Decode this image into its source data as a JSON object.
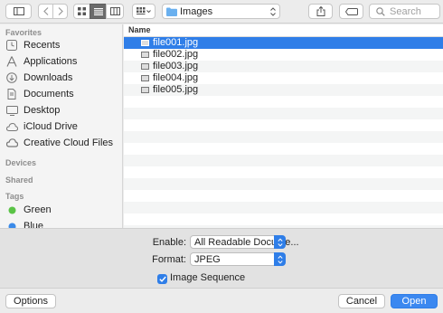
{
  "toolbar": {
    "path_folder": "Images",
    "search_placeholder": "Search"
  },
  "sidebar": {
    "favorites_header": "Favorites",
    "favorites": [
      {
        "label": "Recents",
        "icon": "clock-icon"
      },
      {
        "label": "Applications",
        "icon": "applications-icon"
      },
      {
        "label": "Downloads",
        "icon": "download-icon"
      },
      {
        "label": "Documents",
        "icon": "document-icon"
      },
      {
        "label": "Desktop",
        "icon": "desktop-icon"
      },
      {
        "label": "iCloud Drive",
        "icon": "cloud-icon"
      },
      {
        "label": "Creative Cloud Files",
        "icon": "creative-cloud-icon"
      }
    ],
    "devices_header": "Devices",
    "shared_header": "Shared",
    "tags_header": "Tags",
    "tags": [
      {
        "label": "Green",
        "color": "#5ac346"
      },
      {
        "label": "Blue",
        "color": "#3a8ae8"
      }
    ]
  },
  "filelist": {
    "column_name": "Name",
    "files": [
      {
        "name": "file001.jpg",
        "selected": true
      },
      {
        "name": "file002.jpg",
        "selected": false
      },
      {
        "name": "file003.jpg",
        "selected": false
      },
      {
        "name": "file004.jpg",
        "selected": false
      },
      {
        "name": "file005.jpg",
        "selected": false
      }
    ]
  },
  "options": {
    "enable_label": "Enable:",
    "enable_value": "All Readable Docume...",
    "format_label": "Format:",
    "format_value": "JPEG",
    "sequence_label": "Image Sequence",
    "sequence_checked": true
  },
  "footer": {
    "options_label": "Options",
    "cancel_label": "Cancel",
    "open_label": "Open"
  },
  "colors": {
    "accent": "#2f7ee8",
    "primary_button": "#3b88f0"
  }
}
